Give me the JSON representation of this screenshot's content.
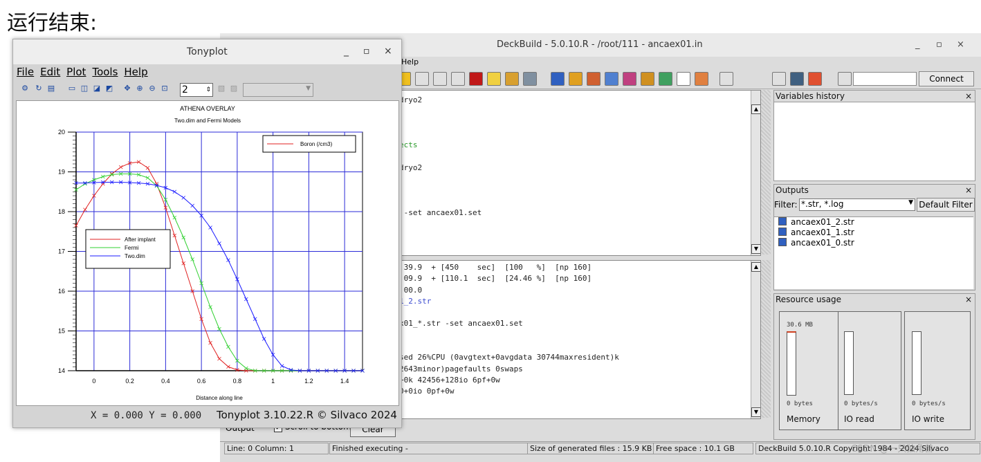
{
  "caption": "运行结束:",
  "deckbuild": {
    "title": "DeckBuild - 5.0.10.R - /root/111 - ancaex01.in",
    "menu_help": "Help",
    "connect_label": "Connect",
    "top_code_lines": [
      "dryo2",
      "",
      "",
      "",
      "ects",
      "",
      "dryo2",
      "",
      "",
      "",
      " -set ancaex01.set"
    ],
    "bottom_code_lines": [
      ":39.9  + [450    sec]  [100   %]  [np 160]",
      ":09.9  + [110.1  sec]  [24.46 %]  [np 160]",
      ":00.0",
      "1_2.str",
      "",
      "x01_*.str -set ancaex01.set",
      "",
      "",
      "sed 26%CPU (0avgtext+0avgdata 30744maxresident)k",
      "2643minor)pagefaults 0swaps",
      "+0k 42456+128io 6pf+0w",
      "0+0io 0pf+0w"
    ],
    "variables_history_label": "Variables history",
    "outputs_label": "Outputs",
    "filter_label": "Filter:",
    "filter_value": "*.str, *.log",
    "default_filter_label": "Default Filter",
    "output_files": [
      "ancaex01_2.str",
      "ancaex01_1.str",
      "ancaex01_0.str"
    ],
    "resource_usage_label": "Resource usage",
    "memory": {
      "value": "30.6 MB",
      "base": "0 bytes",
      "label": "Memory"
    },
    "io_read": {
      "base": "0 bytes/s",
      "label": "IO read"
    },
    "io_write": {
      "base": "0 bytes/s",
      "label": "IO write"
    },
    "output_tab_label": "Output",
    "scroll_to_bottom_label": "Scroll to bottom",
    "clear_label": "Clear",
    "status": {
      "line_col": "Line: 0 Column: 1",
      "state": "Finished executing -",
      "size": "Size of generated files : 15.9 KB",
      "free": "Free space : 10.1 GB",
      "version": "DeckBuild 5.0.10.R  Copyright 1984 - 2024 Silvaco"
    },
    "watermark": "CSDN @一只独角兽",
    "close_glyph": "×"
  },
  "tonyplot": {
    "title": "Tonyplot",
    "menu": [
      "File",
      "Edit",
      "Plot",
      "Tools",
      "Help"
    ],
    "zoom_value": "2",
    "coord_readout": "X = 0.000 Y = 0.000",
    "footer_brand": "Tonyplot 3.10.22.R © Silvaco 2024"
  },
  "chart_data": {
    "type": "line",
    "title": "ATHENA OVERLAY",
    "subtitle": "Two.dim and Fermi Models",
    "xlabel": "Distance along line",
    "ylabel": "",
    "xlim": [
      -0.1,
      1.5
    ],
    "ylim": [
      14,
      20
    ],
    "xticks": [
      0,
      0.2,
      0.4,
      0.6,
      0.8,
      1,
      1.2,
      1.4
    ],
    "yticks": [
      14,
      15,
      16,
      17,
      18,
      19,
      20
    ],
    "xtick_labels": [
      "0",
      "0.2",
      "0.4",
      "0.6",
      "0.8",
      "1",
      "1.2",
      "1.4"
    ],
    "ytick_labels": [
      "14",
      "15",
      "16",
      "17",
      "18",
      "19",
      "20"
    ],
    "grid": true,
    "legend_top_right": "Boron (/cm3)",
    "series": [
      {
        "name": "After implant",
        "color": "#e02020",
        "x": [
          -0.1,
          -0.05,
          0,
          0.05,
          0.1,
          0.15,
          0.2,
          0.25,
          0.3,
          0.35,
          0.4,
          0.45,
          0.5,
          0.55,
          0.6,
          0.65,
          0.7,
          0.75,
          0.8,
          0.85,
          0.9,
          0.95,
          1.0,
          1.05,
          1.1,
          1.15,
          1.2,
          1.25,
          1.3,
          1.35,
          1.4,
          1.45,
          1.5
        ],
        "y": [
          17.65,
          18.05,
          18.4,
          18.7,
          18.95,
          19.12,
          19.22,
          19.25,
          19.1,
          18.7,
          18.1,
          17.4,
          16.7,
          16.0,
          15.3,
          14.7,
          14.3,
          14.1,
          14.02,
          14.0,
          14.0,
          14.0,
          14.0,
          14.0,
          14.0,
          14.0,
          14.0,
          14.0,
          14.0,
          14.0,
          14.0,
          14.0,
          14.0
        ]
      },
      {
        "name": "Fermi",
        "color": "#30d030",
        "x": [
          -0.1,
          -0.05,
          0,
          0.05,
          0.1,
          0.15,
          0.2,
          0.25,
          0.3,
          0.35,
          0.4,
          0.45,
          0.5,
          0.55,
          0.6,
          0.65,
          0.7,
          0.75,
          0.8,
          0.85,
          0.9,
          0.95,
          1.0,
          1.05,
          1.1,
          1.15,
          1.2,
          1.25,
          1.3,
          1.35,
          1.4,
          1.45,
          1.5
        ],
        "y": [
          18.55,
          18.7,
          18.8,
          18.88,
          18.93,
          18.95,
          18.95,
          18.93,
          18.85,
          18.65,
          18.3,
          17.85,
          17.35,
          16.8,
          16.2,
          15.6,
          15.05,
          14.6,
          14.25,
          14.06,
          14.0,
          14.0,
          14.0,
          14.0,
          14.0,
          14.0,
          14.0,
          14.0,
          14.0,
          14.0,
          14.0,
          14.0,
          14.0
        ]
      },
      {
        "name": "Two.dim",
        "color": "#1a1aff",
        "x": [
          -0.1,
          -0.05,
          0,
          0.05,
          0.1,
          0.15,
          0.2,
          0.25,
          0.3,
          0.35,
          0.4,
          0.45,
          0.5,
          0.55,
          0.6,
          0.65,
          0.7,
          0.75,
          0.8,
          0.85,
          0.9,
          0.95,
          1.0,
          1.05,
          1.1,
          1.15,
          1.2,
          1.25,
          1.3,
          1.35,
          1.4,
          1.45,
          1.5
        ],
        "y": [
          18.72,
          18.72,
          18.73,
          18.74,
          18.74,
          18.74,
          18.73,
          18.72,
          18.7,
          18.66,
          18.6,
          18.5,
          18.35,
          18.15,
          17.9,
          17.6,
          17.2,
          16.78,
          16.3,
          15.8,
          15.3,
          14.8,
          14.4,
          14.12,
          14.02,
          14.0,
          14.0,
          14.0,
          14.0,
          14.0,
          14.0,
          14.0,
          14.0
        ]
      }
    ]
  }
}
